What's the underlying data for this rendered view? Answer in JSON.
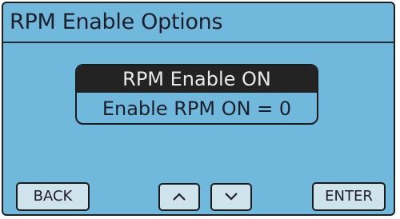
{
  "screen": {
    "title": "RPM Enable Options",
    "background_color": "#71b9dc"
  },
  "options": {
    "selected_label": "RPM Enable ON",
    "value_label": "Enable RPM ON = 0"
  },
  "buttons": {
    "back_label": "BACK",
    "up_icon": "chevron-up-icon",
    "down_icon": "chevron-down-icon",
    "enter_label": "ENTER"
  }
}
